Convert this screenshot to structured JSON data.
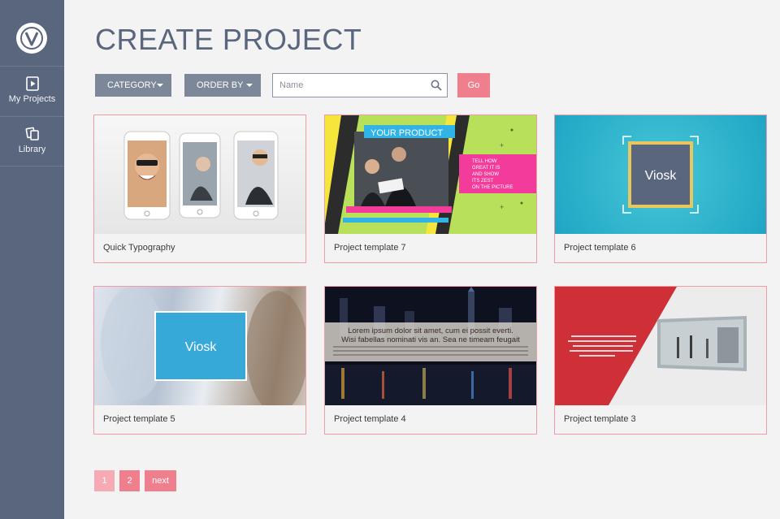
{
  "sidebar": {
    "items": [
      {
        "label": "My Projects",
        "icon": "play-file-icon"
      },
      {
        "label": "Library",
        "icon": "library-icon"
      }
    ]
  },
  "header": {
    "title": "CREATE PROJECT"
  },
  "filters": {
    "category_label": "CATEGORY",
    "order_label": "ORDER BY",
    "search_placeholder": "Name",
    "go_label": "Go"
  },
  "thumbs": {
    "your_product": "YOUR PRODUCT",
    "tell_how": [
      "TELL HOW",
      "GREAT IT IS",
      "AND SHOW",
      "ITS ZEST",
      "ON THE PICTURE"
    ],
    "brand": "Viosk",
    "lorem_line1": "Lorem ipsum dolor sit amet, cum ei possit everti.",
    "lorem_line2": "Wisi fabellas nominati vis an. Sea ne timeam feugait"
  },
  "projects": [
    {
      "label": "Quick Typography"
    },
    {
      "label": "Project template 7"
    },
    {
      "label": "Project template 6"
    },
    {
      "label": "Project template 5"
    },
    {
      "label": "Project template 4"
    },
    {
      "label": "Project template 3"
    }
  ],
  "pagination": {
    "page1": "1",
    "page2": "2",
    "next": "next"
  },
  "colors": {
    "sidebar": "#5a667d",
    "accent": "#f07f8e",
    "card_border": "#f29aa6"
  }
}
